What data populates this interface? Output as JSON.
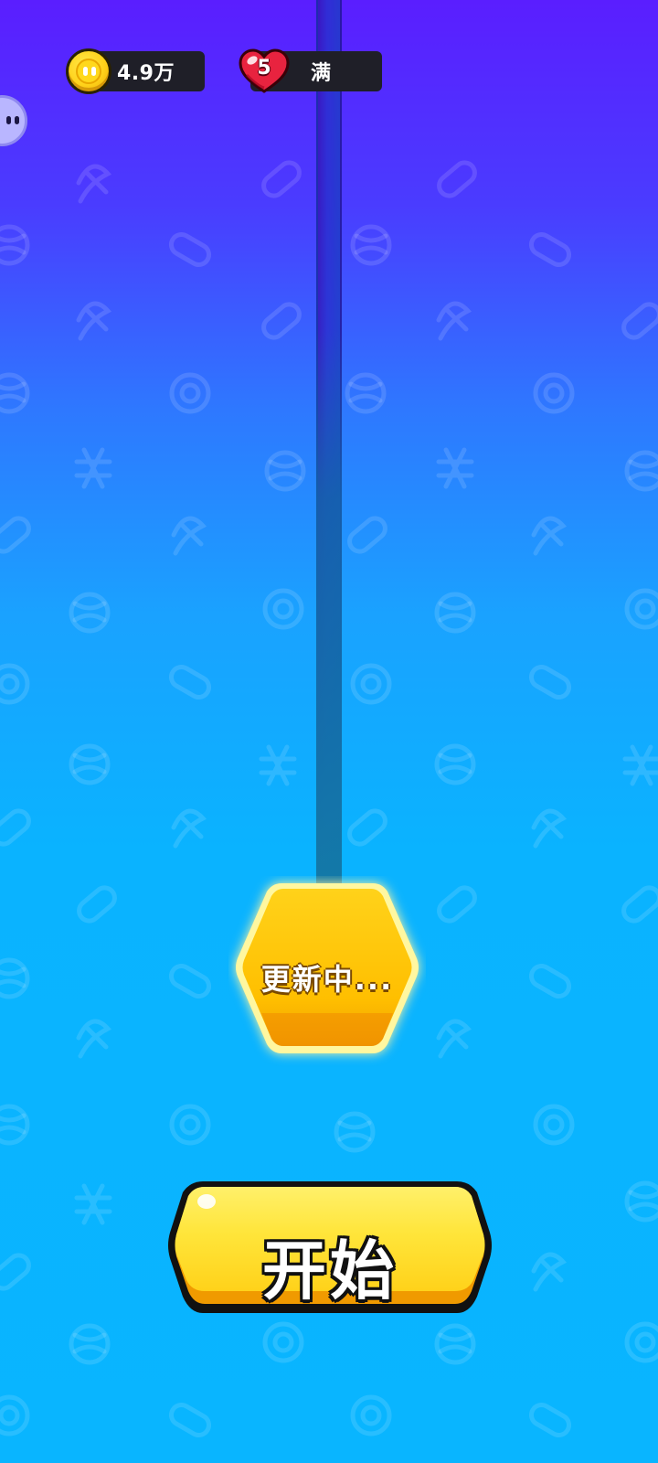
{
  "hud": {
    "coins": {
      "value": "4.9万",
      "icon": "coin-icon"
    },
    "lives": {
      "count": "5",
      "status": "满",
      "icon": "heart-icon"
    }
  },
  "side_button": {
    "icon": "ghost-face-icon"
  },
  "level_badge": {
    "label": "更新中..."
  },
  "start_button": {
    "label": "开始"
  },
  "colors": {
    "background_top": "#5a1eff",
    "background_bottom": "#09b5ff",
    "button_yellow": "#ffd21a",
    "hud_pill": "#1f1f28",
    "heart_red": "#e8233f"
  }
}
